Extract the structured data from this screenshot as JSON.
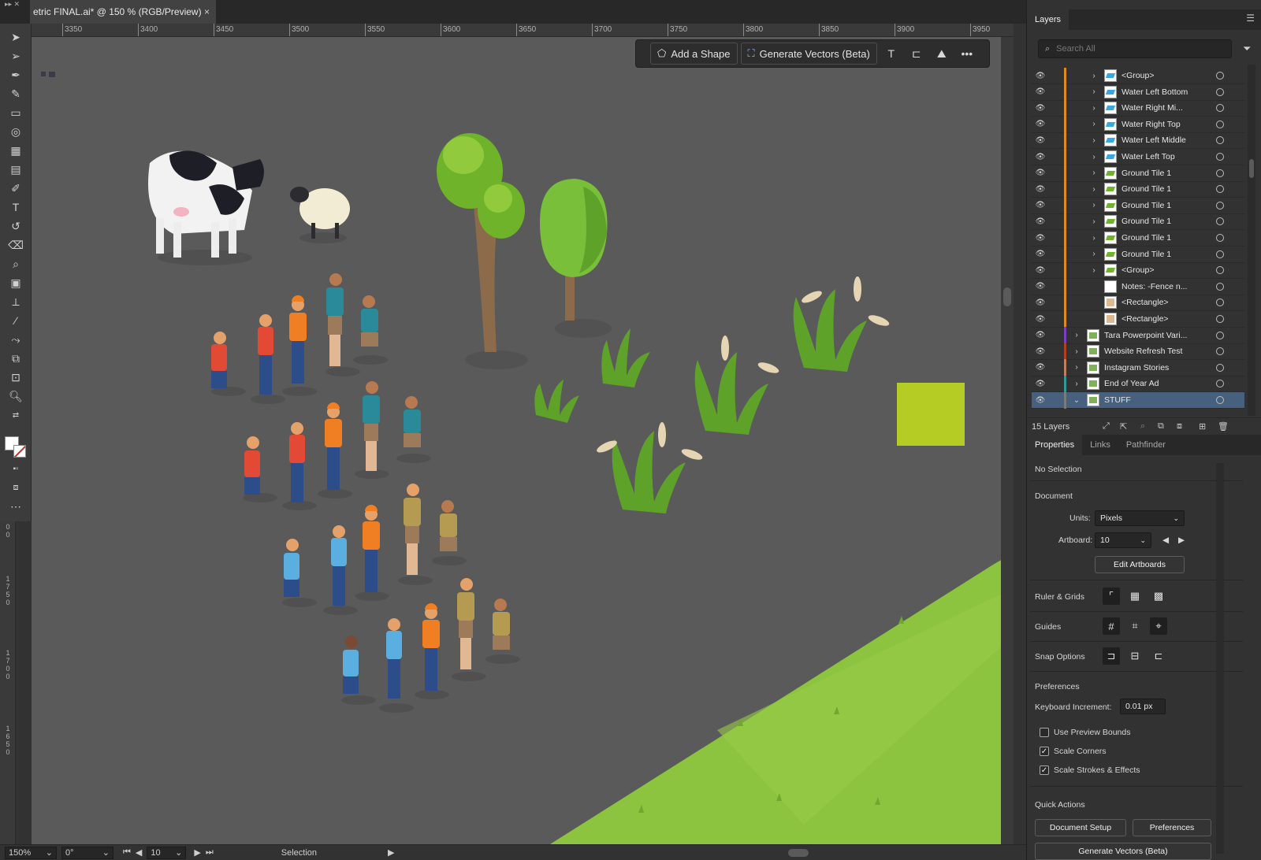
{
  "window": {
    "tab_title": "etric FINAL.ai* @ 150 % (RGB/Preview)",
    "tab_close": "×"
  },
  "ruler": {
    "ticks": [
      "3350",
      "3400",
      "3450",
      "3500",
      "3550",
      "3600",
      "3650",
      "3700",
      "3750",
      "3800",
      "3850",
      "3900",
      "3950"
    ],
    "vertical_ticks": [
      [
        "0",
        "0"
      ],
      [
        "1",
        "7",
        "5",
        "0"
      ],
      [
        "1",
        "7",
        "0",
        "0"
      ],
      [
        "1",
        "6",
        "5",
        "0"
      ]
    ]
  },
  "taskbar": {
    "add_shape": "Add a Shape",
    "generate_vectors": "Generate Vectors (Beta)",
    "more": "•••"
  },
  "statusbar": {
    "zoom": "150%",
    "rotation": "0°",
    "artboard": "10",
    "tool": "Selection"
  },
  "layers_panel": {
    "tab": "Layers",
    "search_placeholder": "Search All",
    "count": "15 Layers",
    "rows": [
      {
        "name": "<Group>",
        "thumb": "water"
      },
      {
        "name": "Water Left Bottom",
        "thumb": "water"
      },
      {
        "name": "Water Right Mi...",
        "thumb": "water"
      },
      {
        "name": "Water Right Top",
        "thumb": "water"
      },
      {
        "name": "Water Left Middle",
        "thumb": "water"
      },
      {
        "name": "Water Left Top",
        "thumb": "water"
      },
      {
        "name": "Ground Tile 1",
        "thumb": "ground"
      },
      {
        "name": "Ground Tile 1",
        "thumb": "ground"
      },
      {
        "name": "Ground Tile 1",
        "thumb": "ground"
      },
      {
        "name": "Ground Tile 1",
        "thumb": "ground"
      },
      {
        "name": "Ground Tile 1",
        "thumb": "ground"
      },
      {
        "name": "Ground Tile 1",
        "thumb": "ground"
      },
      {
        "name": "<Group>",
        "thumb": "ground"
      },
      {
        "name": "Notes: -Fence n...",
        "thumb": "blank"
      },
      {
        "name": "<Rectangle>",
        "thumb": "rect"
      },
      {
        "name": "<Rectangle>",
        "thumb": "rect"
      },
      {
        "name": "Tara Powerpoint Vari...",
        "thumb": "art"
      },
      {
        "name": "Website Refresh Test",
        "thumb": "art"
      },
      {
        "name": "Instagram Stories",
        "thumb": "art"
      },
      {
        "name": "End of Year Ad",
        "thumb": "art"
      },
      {
        "name": "STUFF",
        "thumb": "art"
      }
    ]
  },
  "properties_panel": {
    "tabs": [
      "Properties",
      "Links",
      "Pathfinder"
    ],
    "selection": "No Selection",
    "document_heading": "Document",
    "units_label": "Units:",
    "units_value": "Pixels",
    "artboard_label": "Artboard:",
    "artboard_value": "10",
    "edit_artboards": "Edit Artboards",
    "ruler_grids": "Ruler & Grids",
    "guides": "Guides",
    "snap_options": "Snap Options",
    "preferences_heading": "Preferences",
    "keyboard_increment_label": "Keyboard Increment:",
    "keyboard_increment_value": "0.01 px",
    "use_preview_bounds": "Use Preview Bounds",
    "scale_corners": "Scale Corners",
    "scale_strokes": "Scale Strokes & Effects",
    "quick_actions": "Quick Actions",
    "document_setup": "Document Setup",
    "preferences_button": "Preferences",
    "generate_vectors": "Generate Vectors (Beta)"
  },
  "colors": {
    "canvas": "#5a5a5a",
    "selection_blue": "#46607e",
    "lime_square": "#b5cc25",
    "grass": "#8cc43f"
  }
}
